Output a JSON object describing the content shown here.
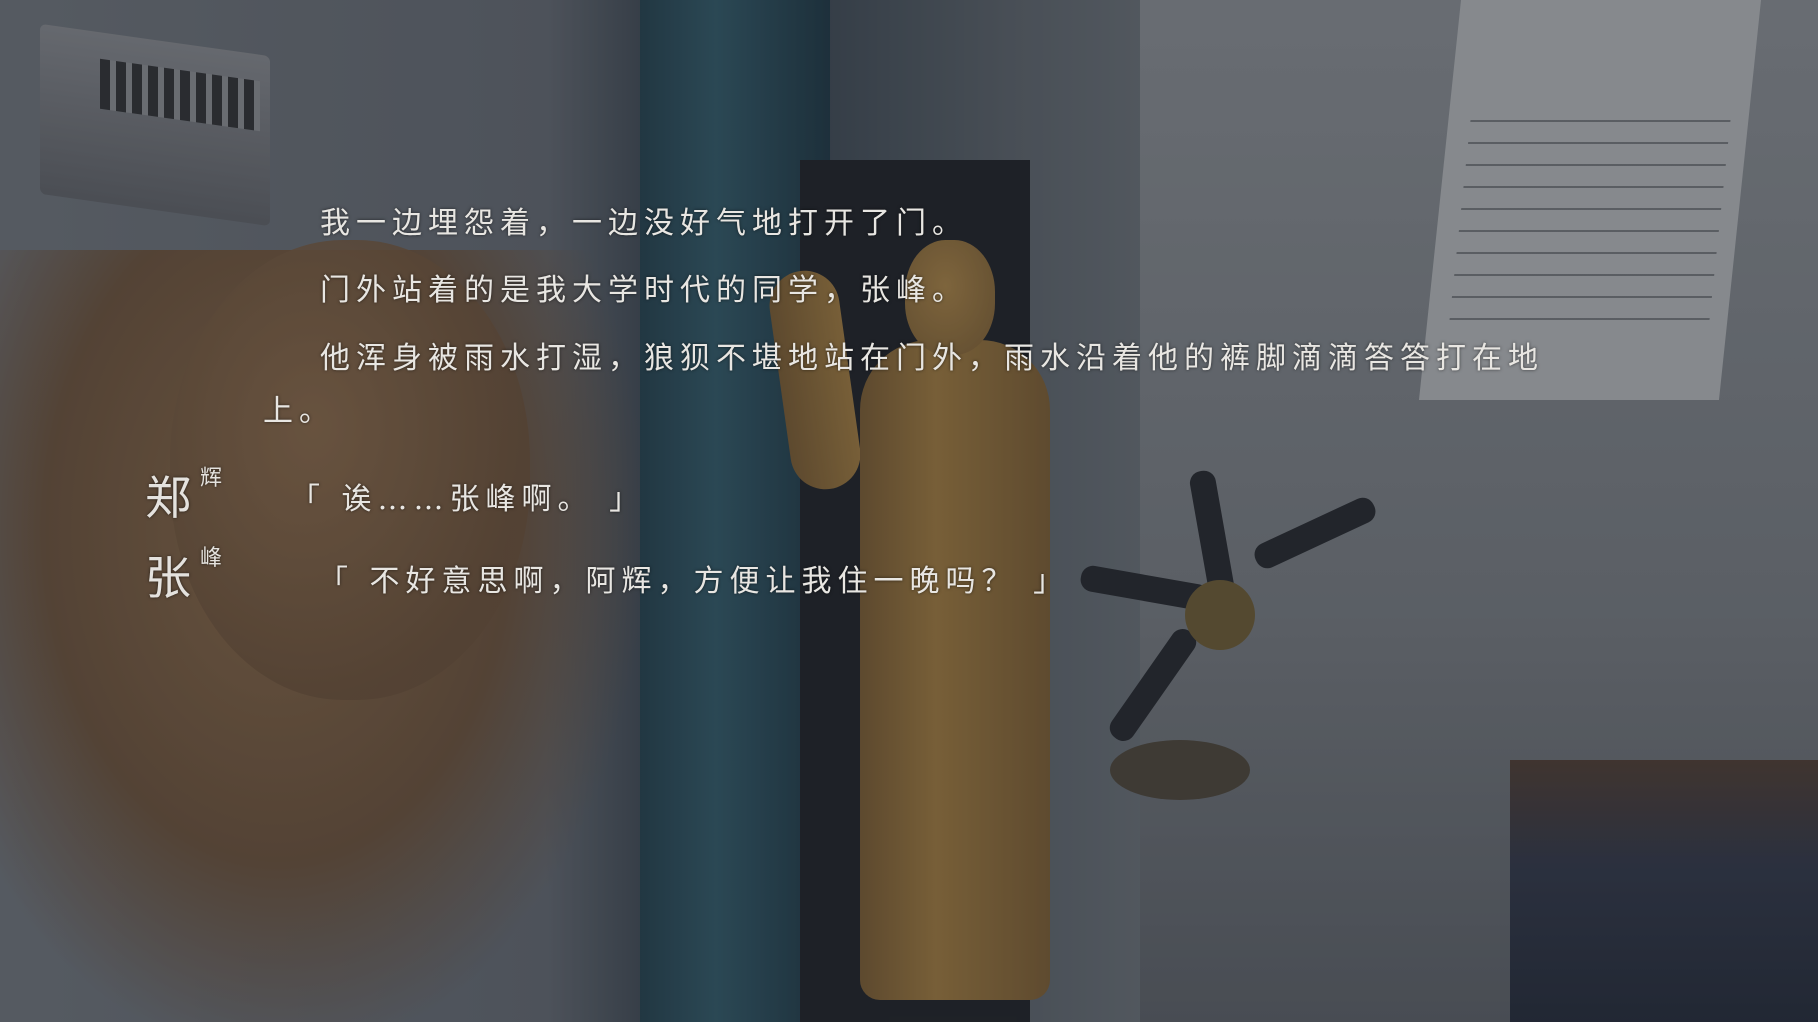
{
  "narration": {
    "line1": "我一边埋怨着，一边没好气地打开了门。",
    "line2": "门外站着的是我大学时代的同学，张峰。",
    "line3a": "他浑身被雨水打湿，狼狈不堪地站在门外，雨水沿着他的裤脚滴滴答答打在地",
    "line3b": "上。"
  },
  "dialogue": [
    {
      "speaker_main": "郑",
      "speaker_sub": "辉",
      "text": "「 诶……张峰啊。 」"
    },
    {
      "speaker_main": "张",
      "speaker_sub": "峰",
      "text": "「 不好意思啊，阿辉，方便让我住一晚吗？ 」"
    }
  ]
}
